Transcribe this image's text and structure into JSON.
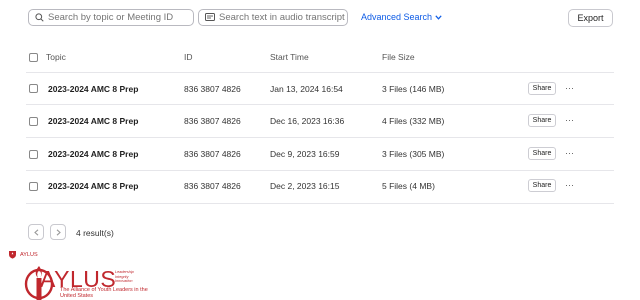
{
  "toolbar": {
    "search_topic_placeholder": "Search by topic or Meeting ID",
    "search_transcript_placeholder": "Search text in audio transcript",
    "advanced_search_label": "Advanced Search",
    "export_label": "Export"
  },
  "table": {
    "columns": [
      "Topic",
      "ID",
      "Start Time",
      "File Size"
    ],
    "rows": [
      {
        "topic": "2023-2024 AMC 8 Prep",
        "id": "836 3807 4826",
        "start_time": "Jan 13, 2024 16:54",
        "file_size": "3 Files (146 MB)",
        "share_label": "Share",
        "more_label": "···"
      },
      {
        "topic": "2023-2024 AMC 8 Prep",
        "id": "836 3807 4826",
        "start_time": "Dec 16, 2023 16:36",
        "file_size": "4 Files (332 MB)",
        "share_label": "Share",
        "more_label": "···"
      },
      {
        "topic": "2023-2024 AMC 8 Prep",
        "id": "836 3807 4826",
        "start_time": "Dec 9, 2023 16:59",
        "file_size": "3 Files (305 MB)",
        "share_label": "Share",
        "more_label": "···"
      },
      {
        "topic": "2023-2024 AMC 8 Prep",
        "id": "836 3807 4826",
        "start_time": "Dec 2, 2023 16:15",
        "file_size": "5 Files (4 MB)",
        "share_label": "Share",
        "more_label": "···"
      }
    ]
  },
  "pagination": {
    "result_count": "4 result(s)"
  },
  "branding": {
    "small_label": "AYLUS",
    "logo_text": "AYLUS",
    "logo_subtitle": "The Alliance of Youth Leaders in the United States",
    "tagline_1": "Leadership",
    "tagline_2": "Integrity",
    "tagline_3": "Innovation"
  },
  "colors": {
    "accent": "#0e5ce6",
    "brand_red": "#c0272d"
  },
  "icons": {
    "search": "search-icon",
    "transcript": "transcript-icon",
    "chevron": "chevron-down-icon",
    "prev": "chevron-left-icon",
    "next": "chevron-right-icon"
  }
}
